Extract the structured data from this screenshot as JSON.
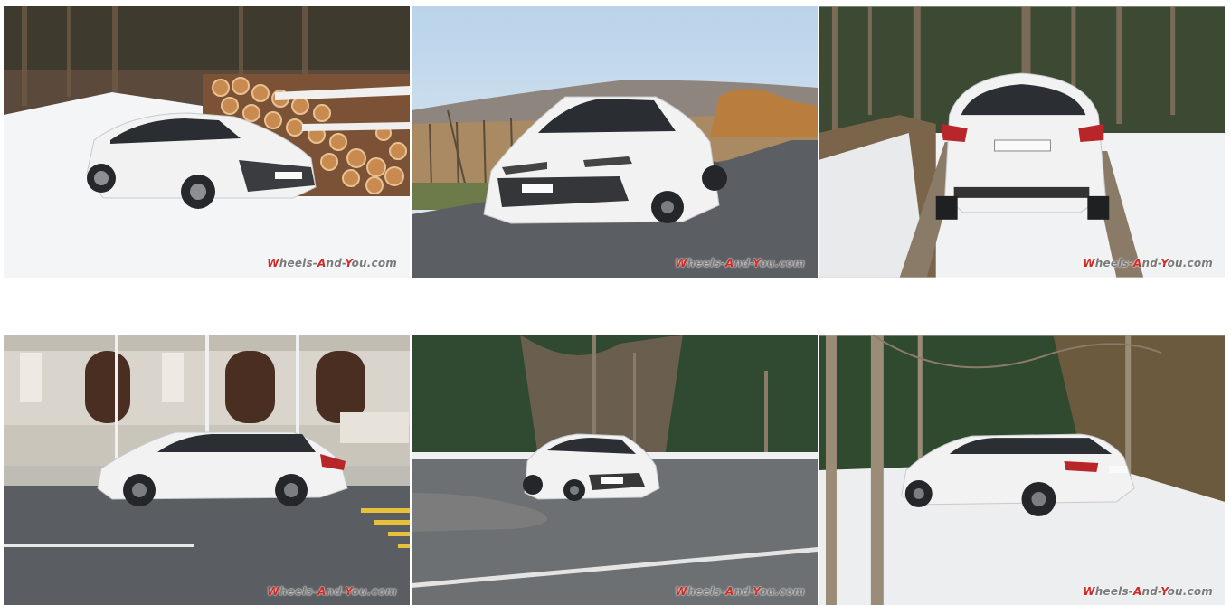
{
  "gallery": {
    "watermark_parts": [
      "W",
      "heels-",
      "A",
      "nd-",
      "Y",
      "ou.com"
    ],
    "colors": {
      "watermark_red": "#cf2a23",
      "watermark_grey": "#7a7a7a",
      "car_white": "#f2f2f2"
    },
    "thumbnails": [
      {
        "scene": "car-by-log-pile-snow"
      },
      {
        "scene": "car-front-vineyard-road"
      },
      {
        "scene": "car-rear-forest-snow"
      },
      {
        "scene": "car-side-city-building"
      },
      {
        "scene": "car-front-forest-curve"
      },
      {
        "scene": "car-rear-three-quarter-forest-snow"
      }
    ]
  }
}
